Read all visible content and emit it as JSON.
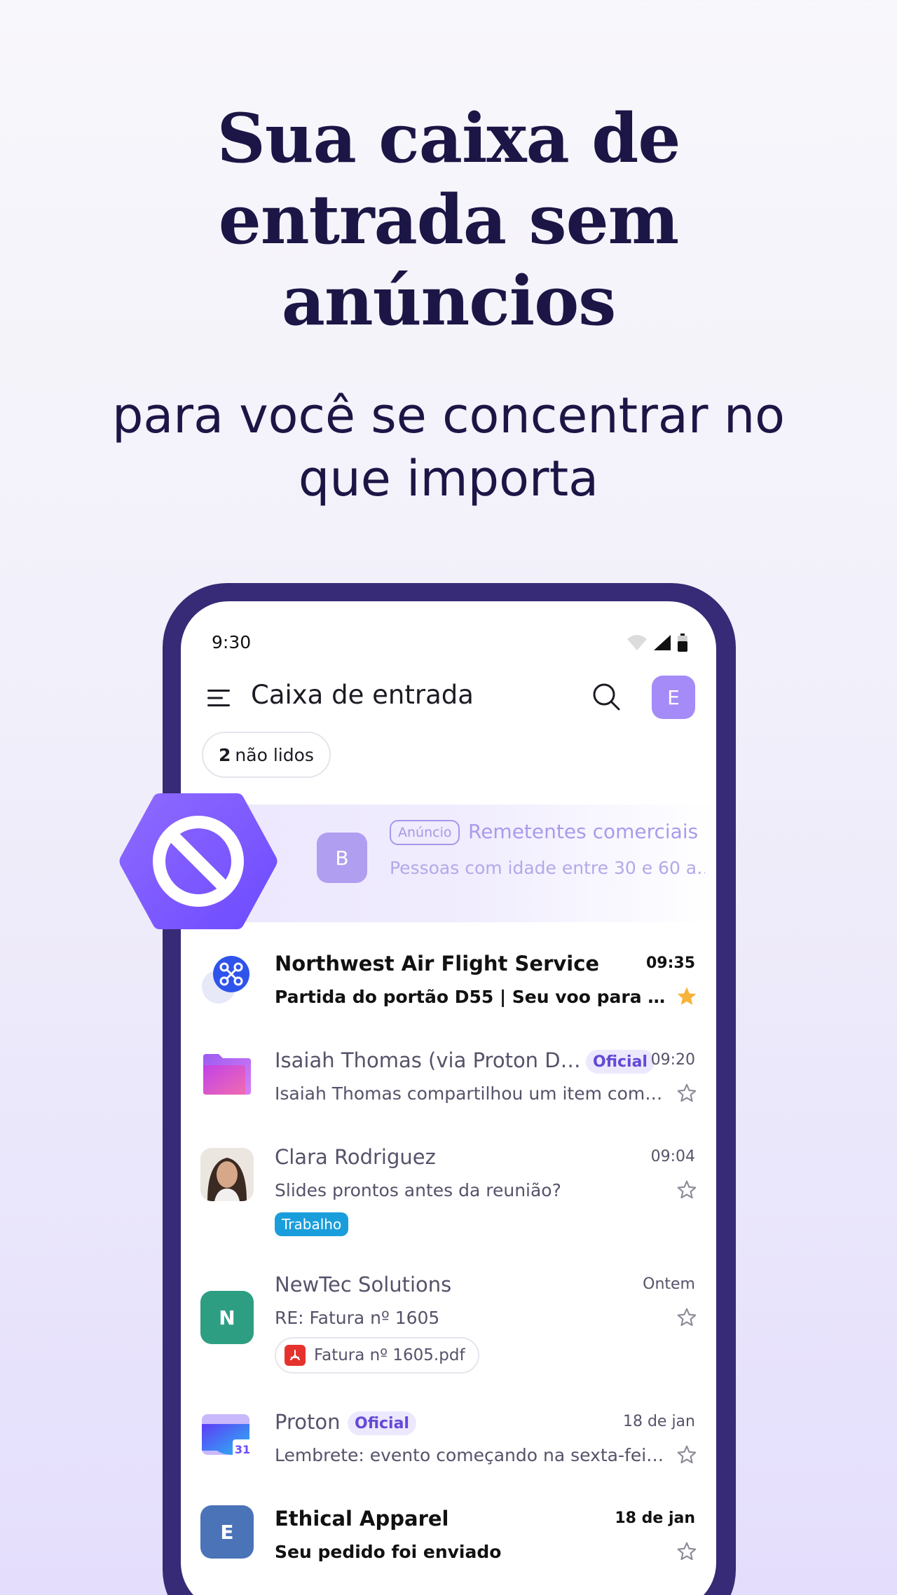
{
  "hero": {
    "title_line1": "Sua caixa de",
    "title_line2": "entrada sem",
    "title_line3": "anúncios",
    "subtitle_line1": "para você se concentrar no",
    "subtitle_line2": "que importa"
  },
  "status_bar": {
    "time": "9:30"
  },
  "app_bar": {
    "title": "Caixa de entrada",
    "account_initial": "E"
  },
  "filter": {
    "unread_count": "2",
    "unread_label": "não lidos"
  },
  "ad": {
    "avatar_letter": "B",
    "badge": "Anúncio",
    "sender": "Remetentes comerciais",
    "preview": "Pessoas com idade entre 30 e 60 a…"
  },
  "messages": [
    {
      "sender": "Northwest Air Flight Service",
      "subject": "Partida do portão D55 | Seu voo para Londres",
      "time": "09:35",
      "unread": true,
      "starred": true
    },
    {
      "sender": "Isaiah Thomas (via Proton Dri…",
      "official": "Oficial",
      "subject": "Isaiah Thomas compartilhou um item com v…",
      "time": "09:20",
      "unread": false,
      "starred": false
    },
    {
      "sender": "Clara Rodriguez",
      "subject": "Slides prontos antes da reunião?",
      "time": "09:04",
      "label": "Trabalho",
      "unread": false,
      "starred": false
    },
    {
      "sender": "NewTec Solutions",
      "avatar_letter": "N",
      "subject": "RE: Fatura nº 1605",
      "attachment": "Fatura nº 1605.pdf",
      "time": "Ontem",
      "unread": false,
      "starred": false
    },
    {
      "sender": "Proton",
      "official": "Oficial",
      "subject": "Lembrete: evento começando na sexta-feira,…",
      "time": "18 de jan",
      "calendar_day": "31",
      "unread": false,
      "starred": false
    },
    {
      "sender": "Ethical Apparel",
      "avatar_letter": "E",
      "subject": "Seu pedido foi enviado",
      "time": "18 de jan",
      "unread": true,
      "starred": false
    }
  ],
  "colors": {
    "brand_purple": "#6d4aff",
    "phone_frame": "#372a76",
    "heading": "#1c1646",
    "star_active": "#f7b33b",
    "label_work": "#1a9edb"
  }
}
